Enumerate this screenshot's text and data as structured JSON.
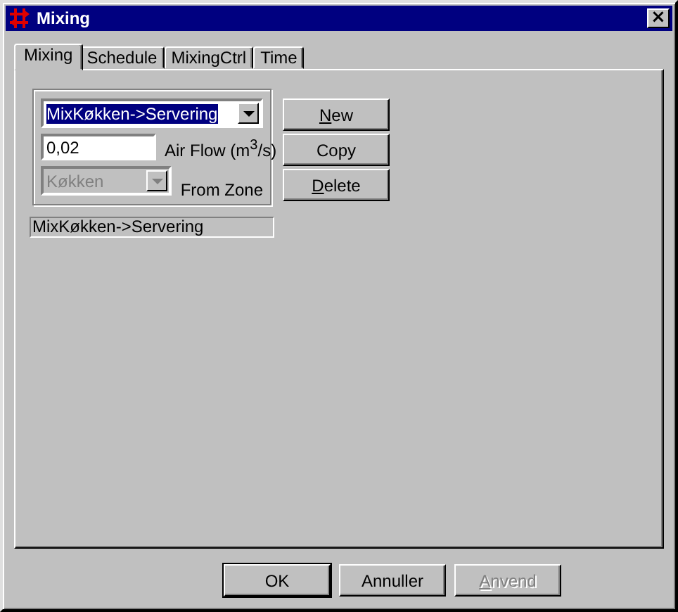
{
  "window": {
    "title": "Mixing",
    "close": "×"
  },
  "tabs": [
    {
      "label": "Mixing",
      "selected": true
    },
    {
      "label": "Schedule",
      "selected": false
    },
    {
      "label": "MixingCtrl",
      "selected": false
    },
    {
      "label": "Time",
      "selected": false
    }
  ],
  "mixing_select": {
    "value": "MixKøkken->Servering",
    "highlighted": true,
    "disabled": false
  },
  "air_flow": {
    "value": "0,02",
    "label": "Air Flow (m$^{3}$/s)"
  },
  "from_zone": {
    "value": "Køkken",
    "label": "From Zone",
    "disabled": true
  },
  "side_buttons": [
    {
      "label": "New",
      "underline_first": true,
      "disabled": false
    },
    {
      "label": "Copy",
      "underline_first": false,
      "disabled": false
    },
    {
      "label": "Delete",
      "underline_first": true,
      "disabled": false
    }
  ],
  "status_field": {
    "value": "MixKøkken->Servering"
  },
  "buttons": [
    {
      "label": "OK",
      "underline_first": false,
      "disabled": false,
      "default": true
    },
    {
      "label": "Annuller",
      "underline_first": false,
      "disabled": false,
      "default": false
    },
    {
      "label": "Anvend",
      "underline_first": true,
      "disabled": true,
      "default": false
    }
  ]
}
